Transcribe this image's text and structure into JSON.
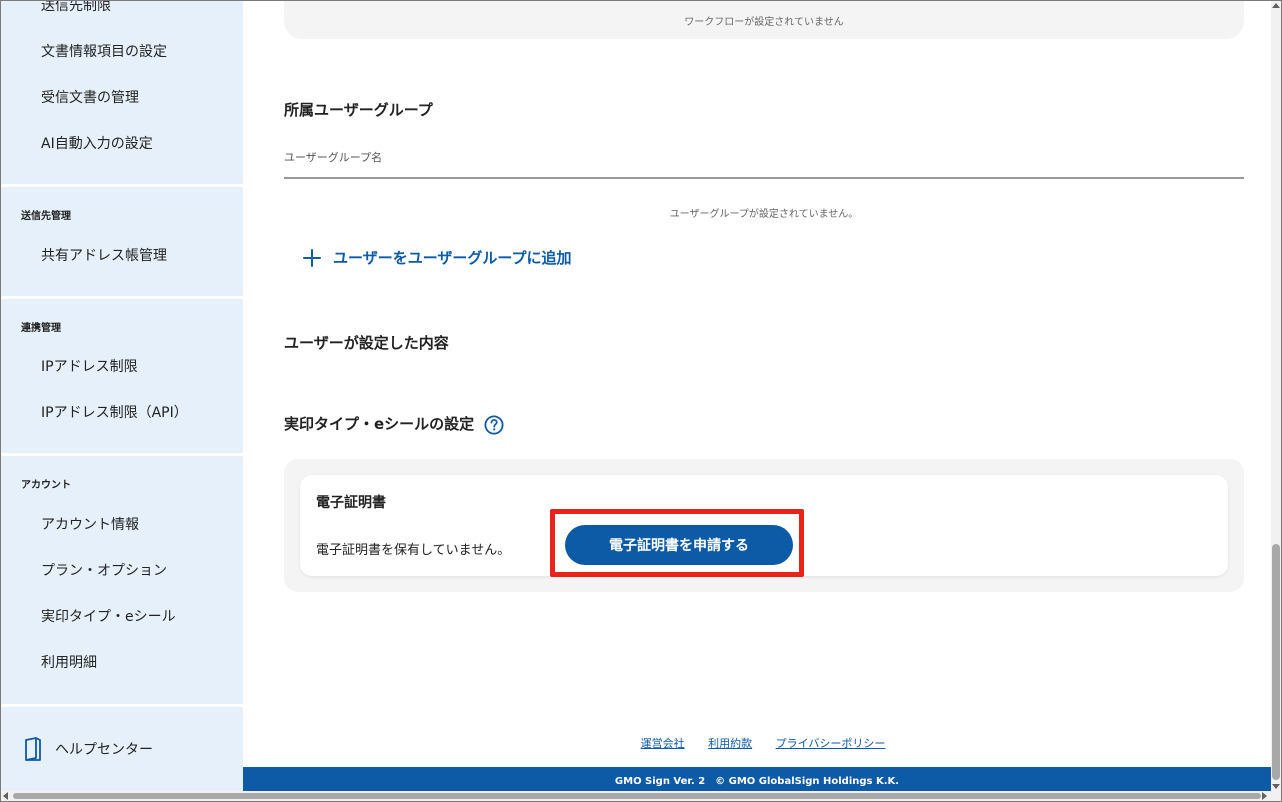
{
  "sidebar": {
    "top_items": [
      {
        "label": "送信先制限"
      },
      {
        "label": "文書情報項目の設定"
      },
      {
        "label": "受信文書の管理"
      },
      {
        "label": "AI自動入力の設定"
      }
    ],
    "groups": [
      {
        "category": "送信先管理",
        "items": [
          {
            "label": "共有アドレス帳管理"
          }
        ]
      },
      {
        "category": "連携管理",
        "items": [
          {
            "label": "IPアドレス制限"
          },
          {
            "label": "IPアドレス制限（API）"
          }
        ]
      },
      {
        "category": "アカウント",
        "items": [
          {
            "label": "アカウント情報"
          },
          {
            "label": "プラン・オプション"
          },
          {
            "label": "実印タイプ・eシール"
          },
          {
            "label": "利用明細"
          }
        ]
      }
    ],
    "help_center": "ヘルプセンター"
  },
  "workflow": {
    "empty_message": "ワークフローが設定されていません"
  },
  "user_groups": {
    "title": "所属ユーザーグループ",
    "column_header": "ユーザーグループ名",
    "empty_message": "ユーザーグループが設定されていません。",
    "add_link": "ユーザーをユーザーグループに追加"
  },
  "user_settings": {
    "title": "ユーザーが設定した内容"
  },
  "seal_settings": {
    "title": "実印タイプ・eシールの設定",
    "certificate": {
      "title": "電子証明書",
      "status": "電子証明書を保有していません。",
      "apply_button": "電子証明書を申請する"
    }
  },
  "footer": {
    "links": [
      "運営会社",
      "利用約款",
      "プライバシーポリシー"
    ],
    "copyright": "GMO Sign Ver. 2　© GMO GlobalSign Holdings K.K."
  },
  "colors": {
    "accent": "#0d5aa7",
    "sidebar_bg": "#e6f0fa",
    "highlight": "#e8231a"
  },
  "icons": {
    "help": "question-circle-icon",
    "add": "plus-icon",
    "help_center": "book-icon"
  }
}
